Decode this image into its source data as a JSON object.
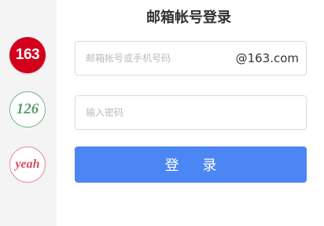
{
  "title": "邮箱帐号登录",
  "brands": [
    {
      "label": "163",
      "color": "#d3001c"
    },
    {
      "label": "126",
      "color": "#5a9e6c"
    },
    {
      "label": "yeah",
      "color": "#d4505f"
    }
  ],
  "selected_brand": "163",
  "form": {
    "username": {
      "value": "",
      "placeholder": "邮箱帐号或手机号码",
      "domain_suffix": "@163.com"
    },
    "password": {
      "value": "",
      "placeholder": "输入密码"
    },
    "submit_label": "登 录"
  },
  "colors": {
    "primary_button": "#4c86f4",
    "sidebar_bg": "#f4f4f4"
  }
}
